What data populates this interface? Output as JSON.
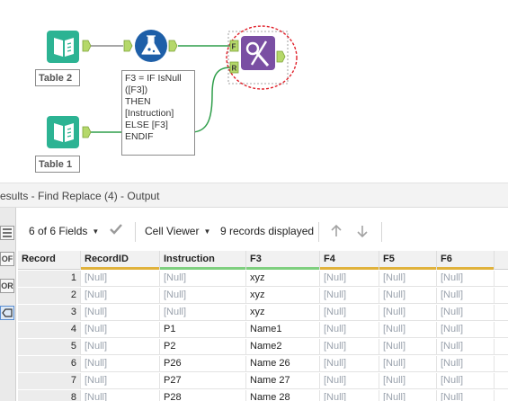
{
  "canvas": {
    "tools": [
      {
        "id": "table2",
        "label": "Table 2"
      },
      {
        "id": "table1",
        "label": "Table 1"
      }
    ],
    "formula": {
      "lines": [
        "F3 = IF IsNull",
        "([F3])",
        "THEN",
        "[Instruction]",
        "ELSE [F3]",
        "ENDIF"
      ]
    },
    "find_replace": {
      "anchor_f": "F",
      "anchor_r": "R"
    }
  },
  "results": {
    "title": "esults - Find Replace (4) - Output",
    "rail": [
      "OF",
      "OR"
    ],
    "toolbar": {
      "fields": "6 of 6 Fields",
      "viewer": "Cell Viewer",
      "records": "9 records displayed"
    },
    "columns": [
      {
        "name": "Record",
        "bar": ""
      },
      {
        "name": "RecordID",
        "bar": "#e0b23c"
      },
      {
        "name": "Instruction",
        "bar": "#7fcf7f"
      },
      {
        "name": "F3",
        "bar": "#7fcf7f"
      },
      {
        "name": "F4",
        "bar": "#e0b23c"
      },
      {
        "name": "F5",
        "bar": "#e0b23c"
      },
      {
        "name": "F6",
        "bar": "#e0b23c"
      }
    ],
    "rows": [
      [
        "1",
        "[Null]",
        "[Null]",
        "xyz",
        "[Null]",
        "[Null]",
        "[Null]"
      ],
      [
        "2",
        "[Null]",
        "[Null]",
        "xyz",
        "[Null]",
        "[Null]",
        "[Null]"
      ],
      [
        "3",
        "[Null]",
        "[Null]",
        "xyz",
        "[Null]",
        "[Null]",
        "[Null]"
      ],
      [
        "4",
        "[Null]",
        "P1",
        "Name1",
        "[Null]",
        "[Null]",
        "[Null]"
      ],
      [
        "5",
        "[Null]",
        "P2",
        "Name2",
        "[Null]",
        "[Null]",
        "[Null]"
      ],
      [
        "6",
        "[Null]",
        "P26",
        "Name 26",
        "[Null]",
        "[Null]",
        "[Null]"
      ],
      [
        "7",
        "[Null]",
        "P27",
        "Name 27",
        "[Null]",
        "[Null]",
        "[Null]"
      ],
      [
        "8",
        "[Null]",
        "P28",
        "Name 28",
        "[Null]",
        "[Null]",
        "[Null]"
      ]
    ]
  },
  "colors": {
    "input_tool": "#2cb393",
    "formula_tool": "#1e5fa8",
    "find_replace_tool": "#7a4fa3",
    "anchor": "#b5d86a",
    "wire_data": "#2f9e4a",
    "wire_gray": "#8a8a8a",
    "selection": "#e0202a"
  }
}
